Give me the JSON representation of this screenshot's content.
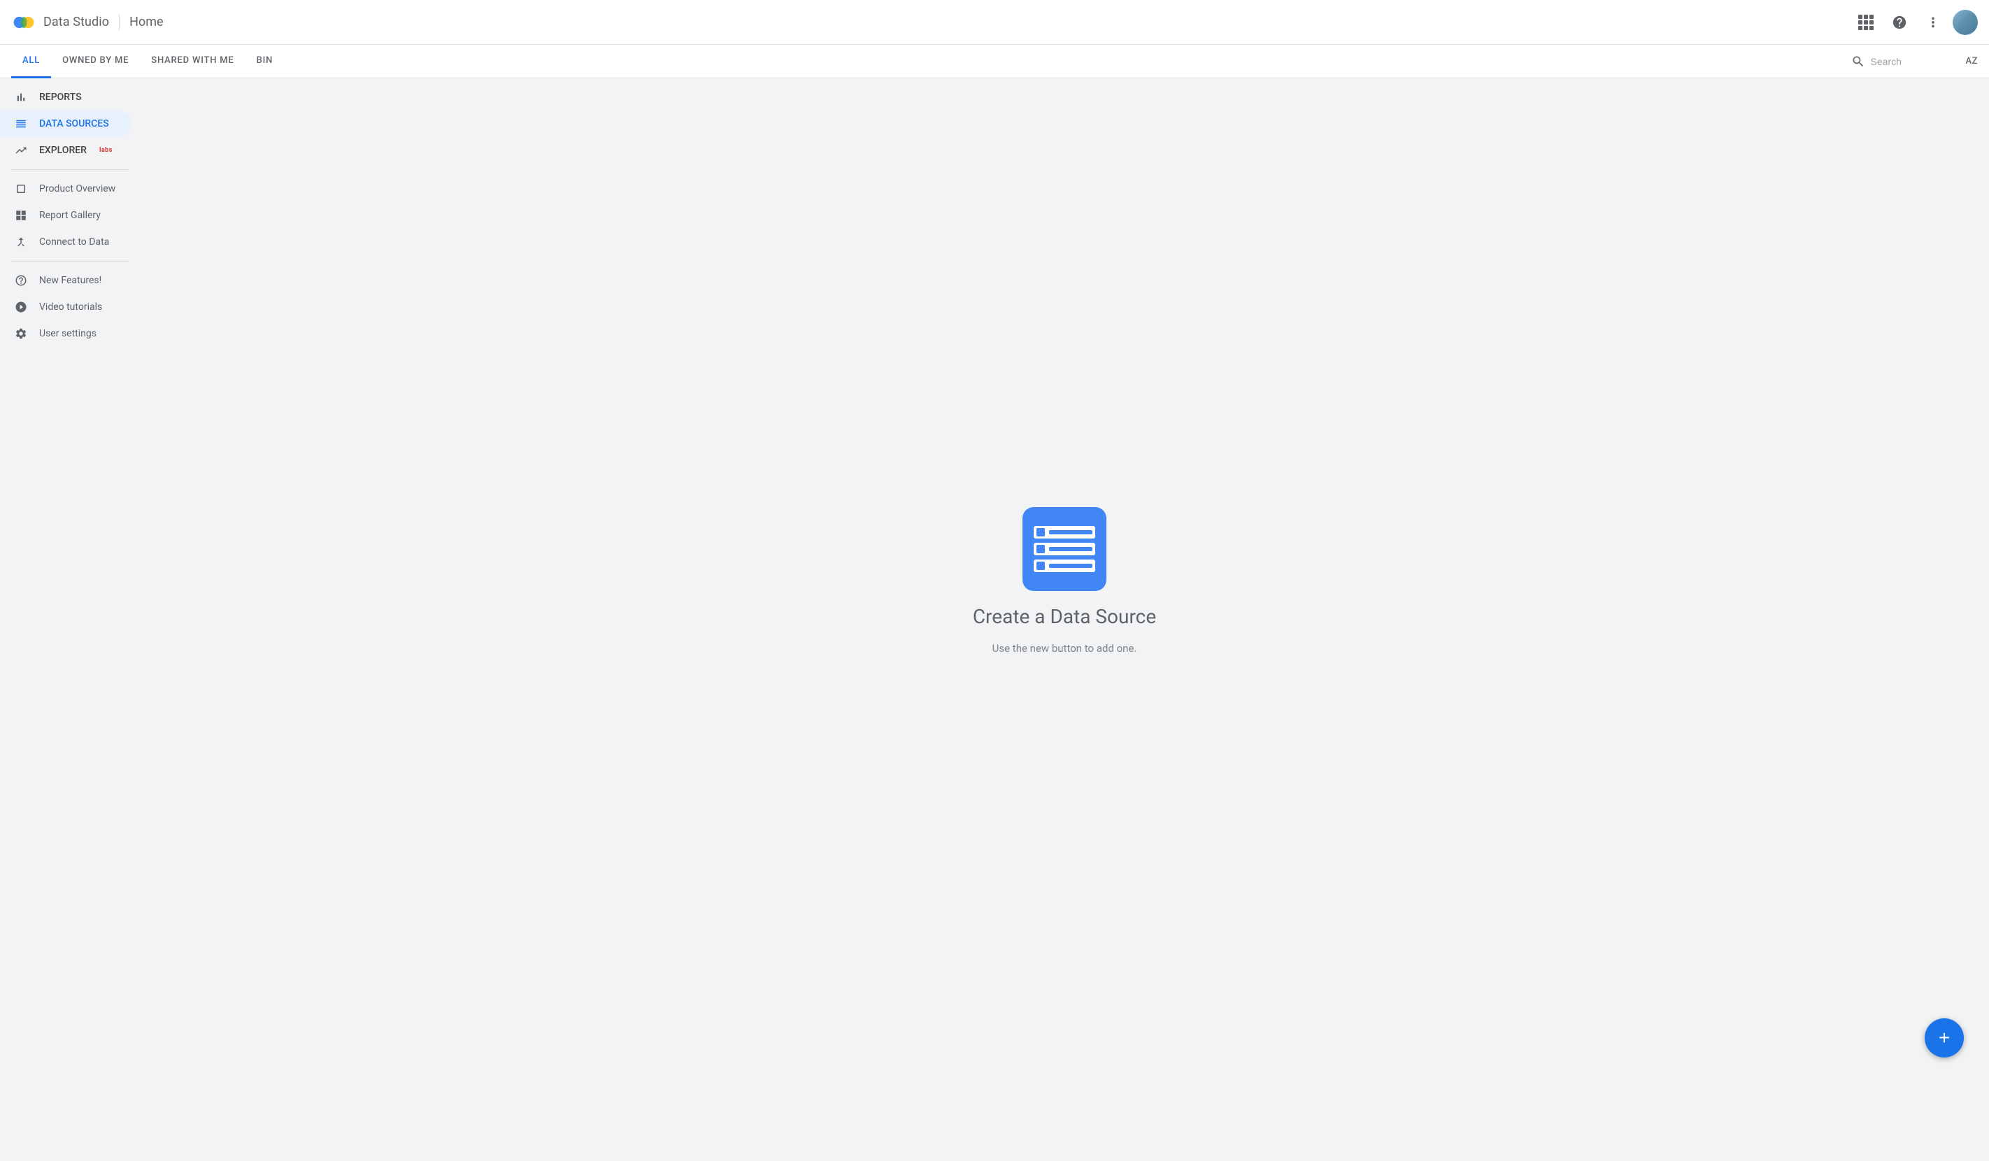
{
  "app": {
    "name": "Data Studio",
    "page_title": "Home"
  },
  "header": {
    "search_placeholder": "Search"
  },
  "tabs": [
    {
      "id": "all",
      "label": "ALL",
      "active": true
    },
    {
      "id": "owned",
      "label": "OWNED BY ME",
      "active": false
    },
    {
      "id": "shared",
      "label": "SHARED WITH ME",
      "active": false
    },
    {
      "id": "bin",
      "label": "BIN",
      "active": false
    }
  ],
  "sidebar": {
    "nav_items": [
      {
        "id": "reports",
        "label": "REPORTS",
        "icon": "bar_chart"
      },
      {
        "id": "data_sources",
        "label": "DATA SOURCES",
        "icon": "table_rows",
        "active": true
      },
      {
        "id": "explorer",
        "label": "EXPLORER",
        "icon": "trending_up",
        "labs": true
      }
    ],
    "secondary_items": [
      {
        "id": "product_overview",
        "label": "Product Overview",
        "icon": "crop_square"
      },
      {
        "id": "report_gallery",
        "label": "Report Gallery",
        "icon": "grid_view"
      },
      {
        "id": "connect_to_data",
        "label": "Connect to Data",
        "icon": "merge_type"
      }
    ],
    "footer_items": [
      {
        "id": "new_features",
        "label": "New Features!",
        "icon": "settings"
      },
      {
        "id": "video_tutorials",
        "label": "Video tutorials",
        "icon": "play_circle"
      },
      {
        "id": "user_settings",
        "label": "User settings",
        "icon": "settings"
      }
    ]
  },
  "empty_state": {
    "title": "Create a Data Source",
    "subtitle": "Use the new button to add one."
  },
  "fab": {
    "label": "+"
  }
}
